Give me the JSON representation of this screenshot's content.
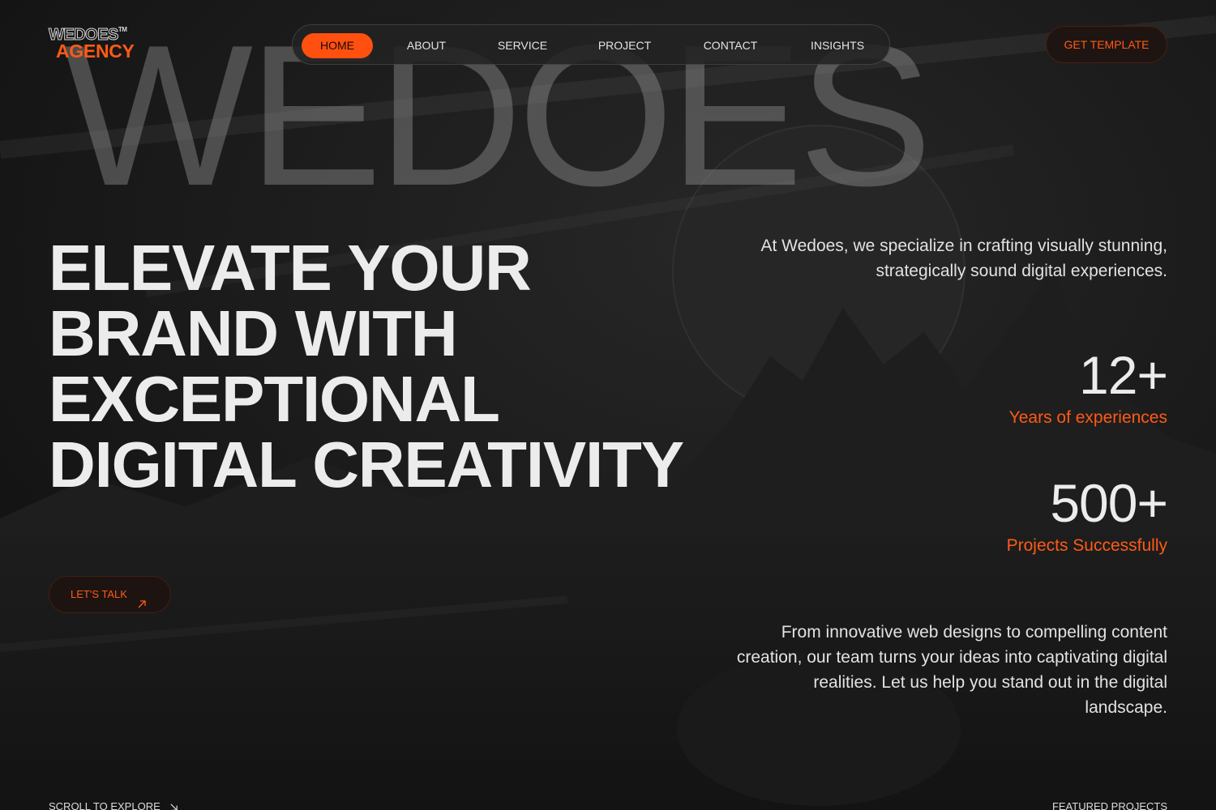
{
  "colors": {
    "accent": "#ff5a16",
    "background": "#131313",
    "text": "#ececec"
  },
  "hero": {
    "wordmark": "WEDOES"
  },
  "logo": {
    "top": "WEDOES",
    "trademark": "TM",
    "bottom": "AGENCY"
  },
  "nav": {
    "items": [
      {
        "label": "HOME",
        "active": true
      },
      {
        "label": "ABOUT"
      },
      {
        "label": "SERVICE"
      },
      {
        "label": "PROJECT"
      },
      {
        "label": "CONTACT"
      },
      {
        "label": "INSIGHTS"
      }
    ]
  },
  "header": {
    "cta_label": "GET TEMPLATE"
  },
  "headline": [
    "ELEVATE YOUR",
    "BRAND WITH",
    "EXCEPTIONAL",
    "DIGITAL CREATIVITY"
  ],
  "intro": "At Wedoes, we specialize in crafting visually stunning, strategically sound digital experiences.",
  "stats": [
    {
      "value": "12+",
      "label": "Years of experiences"
    },
    {
      "value": "500+",
      "label": "Projects Successfully"
    }
  ],
  "cta": {
    "label": "LET'S TALK",
    "icon": "arrow-up-right-icon"
  },
  "description": "From innovative web designs to compelling content creation, our team turns your ideas into captivating digital realities. Let us help you stand out in the digital landscape.",
  "footer": {
    "scroll_label": "SCROLL TO EXPLORE",
    "scroll_icon": "arrow-down-right-icon",
    "featured_label": "FEATURED PROJECTS"
  }
}
